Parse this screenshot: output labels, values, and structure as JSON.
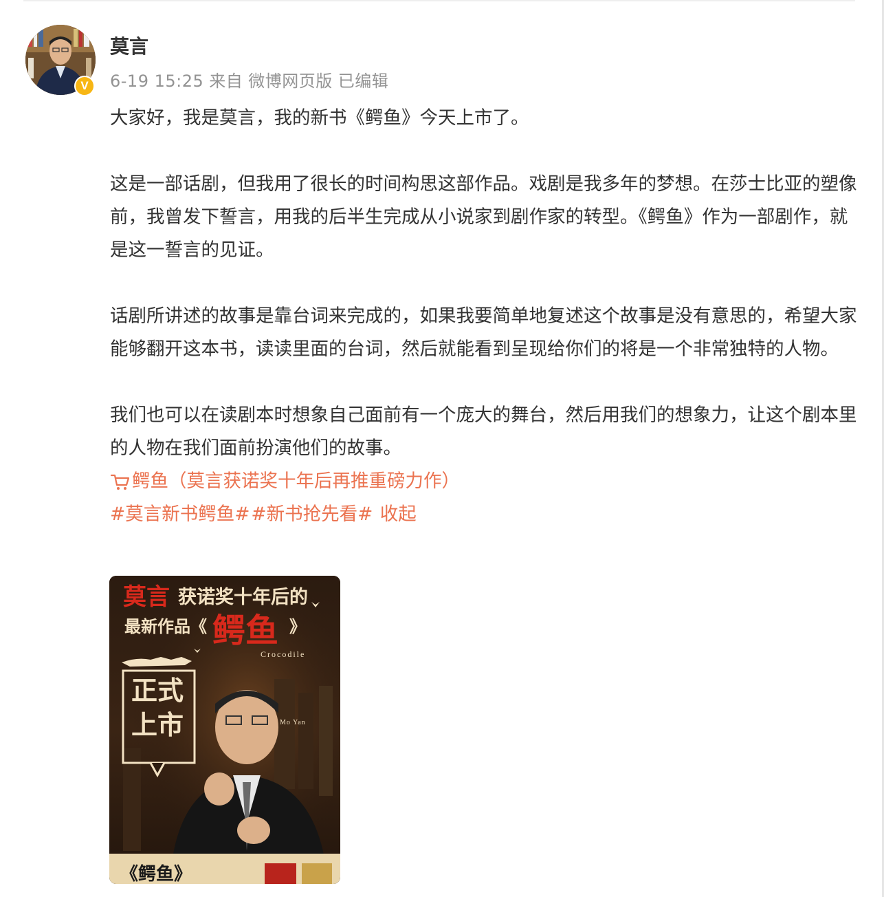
{
  "post": {
    "username": "莫言",
    "date": "6-19 15:25",
    "source_prefix": "来自",
    "source": "微博网页版",
    "edited": "已编辑",
    "verified_badge": "V",
    "paragraphs": [
      "大家好，我是莫言，我的新书《鳄鱼》今天上市了。",
      "这是一部话剧，但我用了很长的时间构思这部作品。戏剧是我多年的梦想。在莎士比亚的塑像前，我曾发下誓言，用我的后半生完成从小说家到剧作家的转型。《鳄鱼》作为一部剧作，就是这一誓言的见证。",
      "话剧所讲述的故事是靠台词来完成的，如果我要简单地复述这个故事是没有意思的，希望大家能够翻开这本书，读读里面的台词，然后就能看到呈现给你们的将是一个非常独特的人物。",
      "我们也可以在读剧本时想象自己面前有一个庞大的舞台，然后用我们的想象力，让这个剧本里的人物在我们面前扮演他们的故事。"
    ],
    "product_link": "鳄鱼（莫言获诺奖十年后再推重磅力作）",
    "hashtags": [
      "#莫言新书鳄鱼#",
      "#新书抢先看#"
    ],
    "collapse": "收起"
  },
  "poster": {
    "headline_name": "莫言",
    "headline_1": "获诺奖十年后的",
    "headline_2": "最新作品《",
    "headline_close": "》",
    "title": "鳄鱼",
    "subtitle": "Crocodile",
    "badge_1": "正式",
    "badge_2": "上市",
    "author_en": "Mo Yan",
    "bottom_title": "《鳄鱼》"
  },
  "colors": {
    "accent": "#eb7350",
    "meta_gray": "#939393",
    "verified": "#f7b614",
    "poster_red": "#d8291c",
    "poster_cream": "#f3e2c3"
  }
}
